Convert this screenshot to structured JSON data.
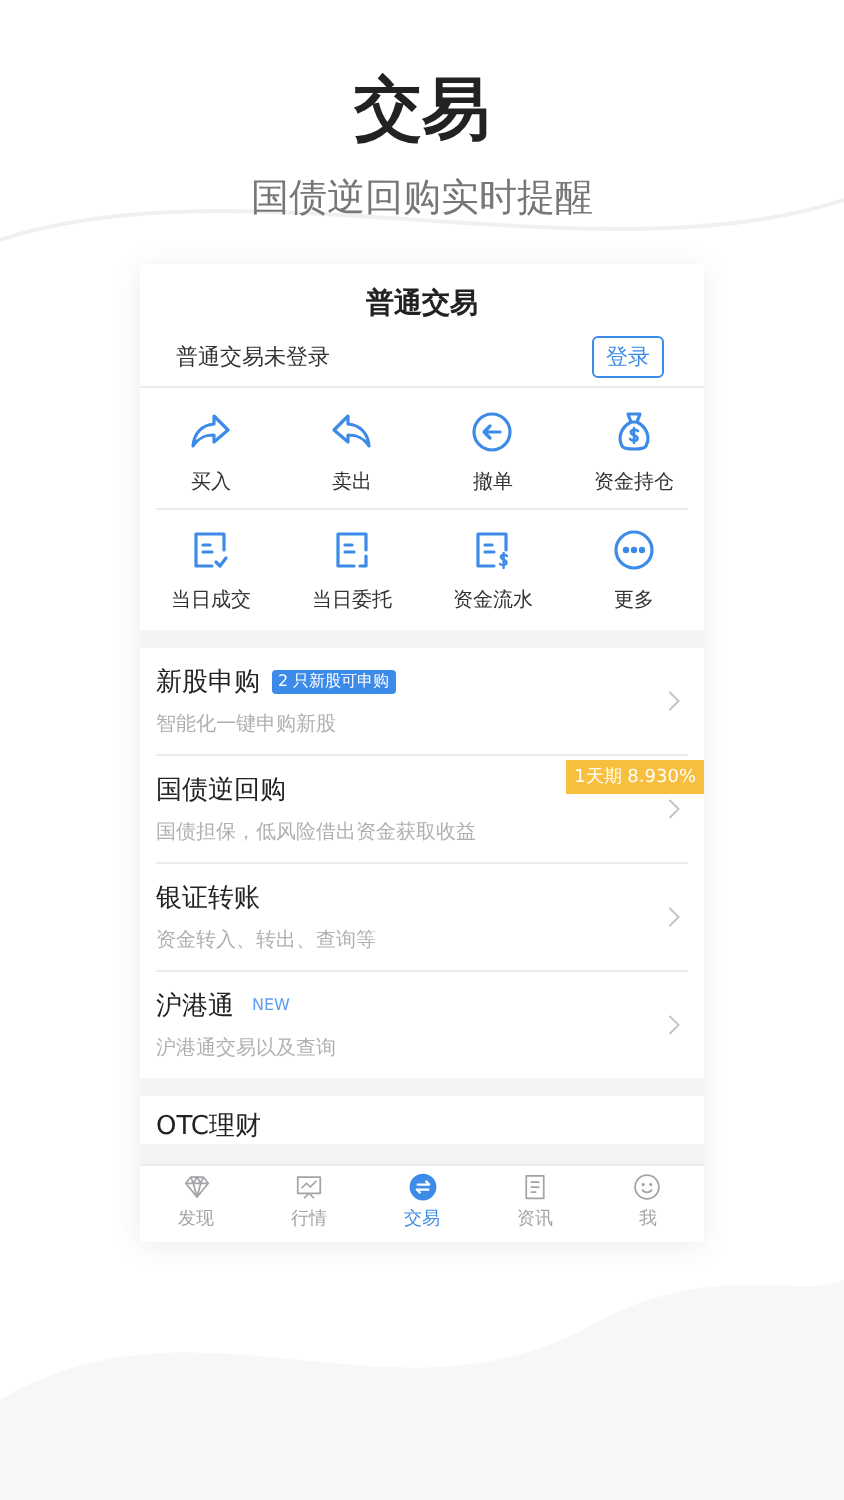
{
  "header": {
    "title": "交易",
    "subtitle": "国债逆回购实时提醒"
  },
  "card": {
    "title": "普通交易",
    "login_status": "普通交易未登录",
    "login_button": "登录"
  },
  "actions": [
    {
      "label": "买入"
    },
    {
      "label": "卖出"
    },
    {
      "label": "撤单"
    },
    {
      "label": "资金持仓"
    },
    {
      "label": "当日成交"
    },
    {
      "label": "当日委托"
    },
    {
      "label": "资金流水"
    },
    {
      "label": "更多"
    }
  ],
  "services": [
    {
      "title": "新股申购",
      "subtitle": "智能化一键申购新股",
      "badge": {
        "text": "2 只新股可申购",
        "kind": "tag"
      }
    },
    {
      "title": "国债逆回购",
      "subtitle": "国债担保，低风险借出资金获取收益",
      "ribbon": "1天期 8.930%"
    },
    {
      "title": "银证转账",
      "subtitle": "资金转入、转出、查询等"
    },
    {
      "title": "沪港通",
      "subtitle": "沪港通交易以及查询",
      "badge": {
        "text": "NEW",
        "kind": "new"
      }
    }
  ],
  "more_section": {
    "title": "OTC理财"
  },
  "tab_bar": [
    {
      "label": "发现",
      "selected": false
    },
    {
      "label": "行情",
      "selected": false
    },
    {
      "label": "交易",
      "selected": true
    },
    {
      "label": "资讯",
      "selected": false
    },
    {
      "label": "我",
      "selected": false
    }
  ]
}
